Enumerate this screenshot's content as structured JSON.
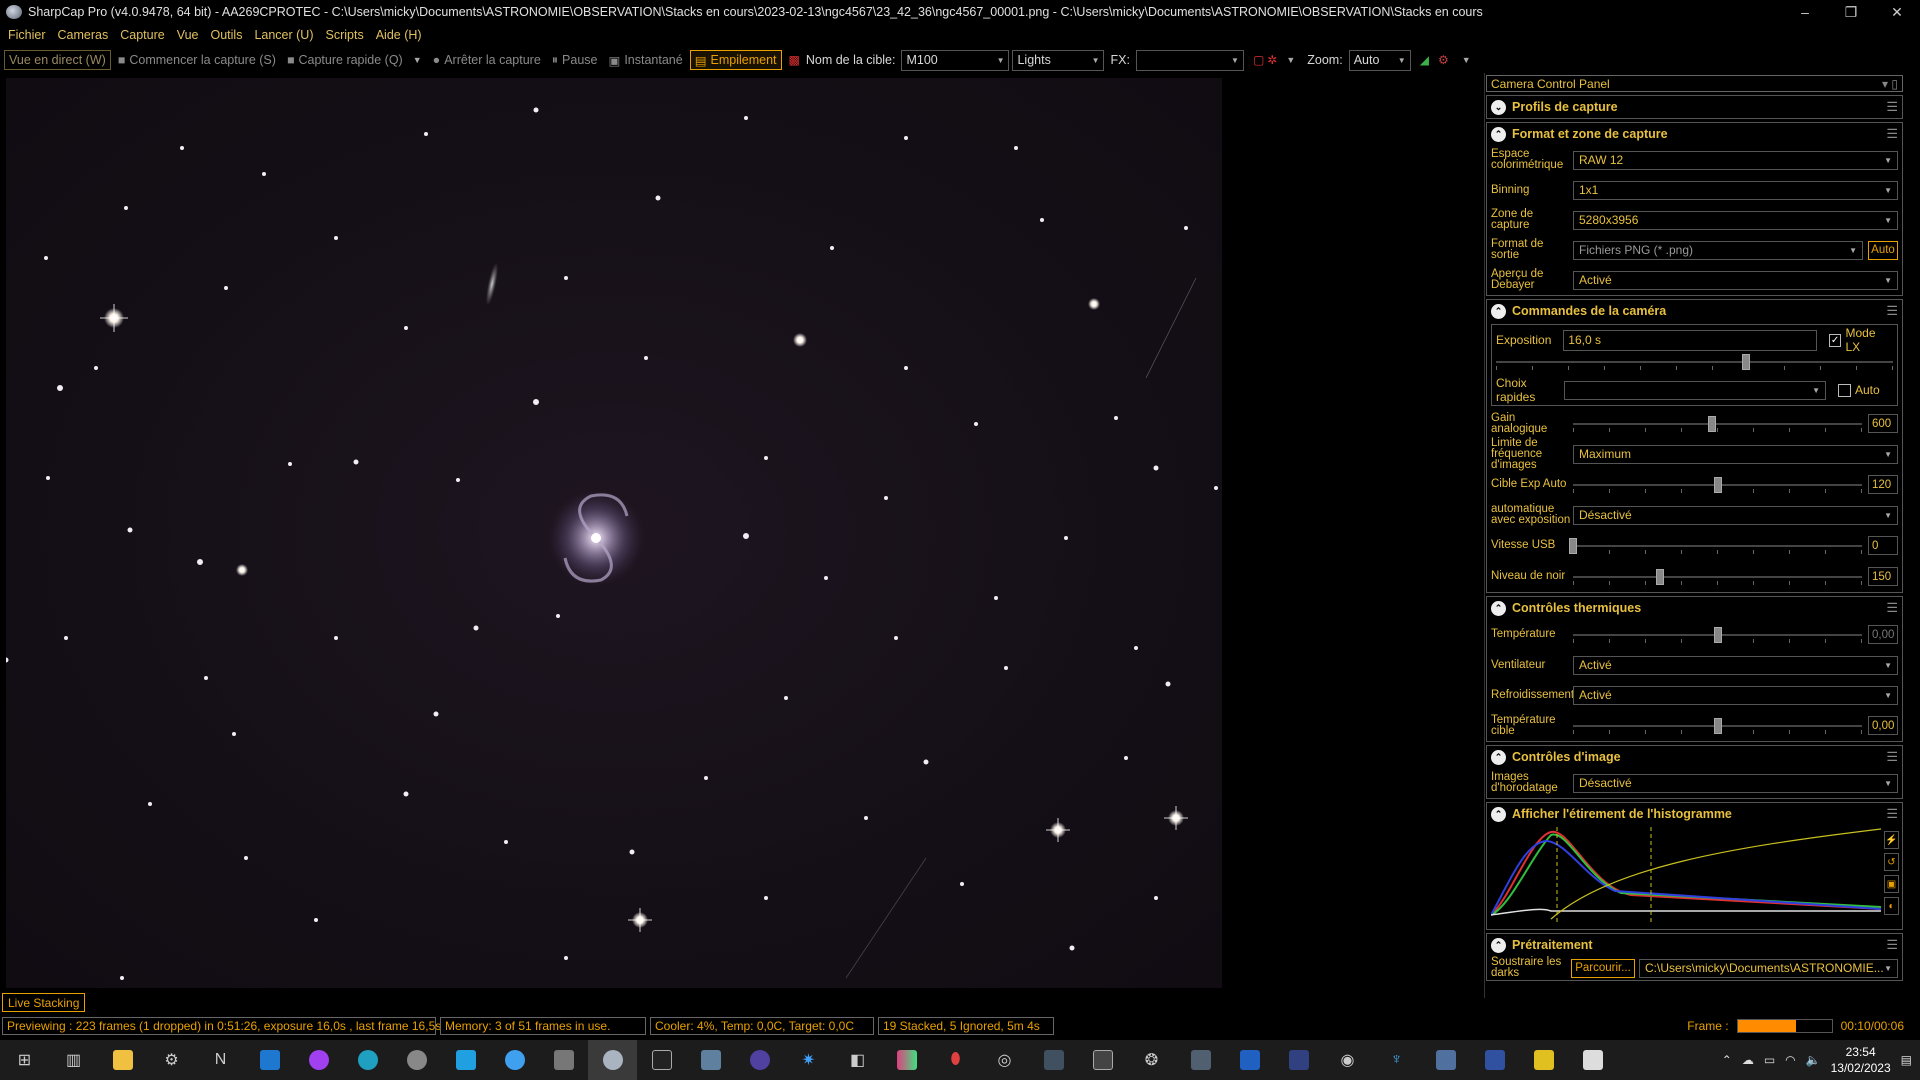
{
  "window": {
    "title": "SharpCap Pro (v4.0.9478, 64 bit) - AA269CPROTEC - C:\\Users\\micky\\Documents\\ASTRONOMIE\\OBSERVATION\\Stacks en cours\\2023-02-13\\ngc4567\\23_42_36\\ngc4567_00001.png - C:\\Users\\micky\\Documents\\ASTRONOMIE\\OBSERVATION\\Stacks en cours",
    "minimize": "–",
    "maximize": "❐",
    "close": "✕"
  },
  "menu": {
    "items": [
      "Fichier",
      "Cameras",
      "Capture",
      "Vue",
      "Outils",
      "Lancer (U)",
      "Scripts",
      "Aide (H)"
    ]
  },
  "toolbar": {
    "live_view": "Vue en direct (W)",
    "start_capture": "Commencer la capture (S)",
    "quick_capture": "Capture rapide (Q)",
    "stop_capture": "Arrêter la capture",
    "pause": "Pause",
    "snapshot": "Instantané",
    "stacking": "Empilement",
    "target_label": "Nom de la cible:",
    "target_value": "M100",
    "frame_type": "Lights",
    "fx_label": "FX:",
    "fx_value": "",
    "zoom_label": "Zoom:",
    "zoom_value": "Auto"
  },
  "live_stacking_tab": "Live Stacking",
  "panel": {
    "title": "Camera Control Panel",
    "sections": {
      "profiles": "Profils de capture",
      "format": "Format et zone de capture",
      "camera": "Commandes de la caméra",
      "thermal": "Contrôles thermiques",
      "image": "Contrôles d'image",
      "histogram": "Afficher l'étirement de l'histogramme",
      "preprocessing": "Prétraitement"
    },
    "format": {
      "colorspace_label": "Espace colorimétrique",
      "colorspace": "RAW 12",
      "binning_label": "Binning",
      "binning": "1x1",
      "zone_label": "Zone de capture",
      "zone": "5280x3956",
      "output_label": "Format de sortie",
      "output": "Fichiers PNG (* .png)",
      "output_auto": "Auto",
      "debayer_label": "Aperçu de Debayer",
      "debayer": "Activé"
    },
    "camera": {
      "exposure_label": "Exposition",
      "exposure": "16,0 s",
      "lx_label": "Mode LX",
      "quick_label": "Choix rapides",
      "quick_auto": "Auto",
      "gain_label": "Gain analogique",
      "gain": "600",
      "gain_level": 0.48,
      "fps_label": "Limite de fréquence d'images",
      "fps": "Maximum",
      "target_exp_label": "Cible Exp Auto",
      "target_exp": "120",
      "target_exp_level": 0.5,
      "auto_exp_label": "automatique avec exposition",
      "auto_exp": "Désactivé",
      "usb_label": "Vitesse USB",
      "usb": "0",
      "usb_level": 0.0,
      "black_label": "Niveau de noir",
      "black": "150",
      "black_level": 0.3
    },
    "thermal": {
      "temp_label": "Température",
      "temp": "0,00",
      "temp_level": 0.5,
      "fan_label": "Ventilateur",
      "fan": "Activé",
      "cooling_label": "Refroidissement",
      "cooling": "Activé",
      "target_temp_label": "Température cible",
      "target_temp": "0,00",
      "target_temp_level": 0.5
    },
    "image": {
      "timestamp_label": "Images d'horodatage",
      "timestamp": "Désactivé"
    },
    "pre": {
      "darks_label": "Soustraire les darks",
      "browse": "Parcourir...",
      "darks_path": "C:\\Users\\micky\\Documents\\ASTRONOMIE..."
    }
  },
  "status": {
    "preview": "Previewing : 223 frames (1 dropped) in 0:51:26, exposure 16,0s , last frame 16,5s",
    "memory": "Memory: 3 of 51 frames in use.",
    "cooler": "Cooler: 4%, Temp: 0,0C, Target: 0,0C",
    "stacked": "19 Stacked, 5 Ignored, 5m 4s",
    "frame_label": "Frame :",
    "frame_progress": 0.62,
    "frame_time": "00:10/00:06"
  },
  "taskbar": {
    "time": "23:54",
    "date": "13/02/2023",
    "icons": [
      "windows-start-icon",
      "task-view-icon",
      "file-explorer-icon",
      "settings-icon",
      "notion-icon",
      "mail-icon",
      "messenger-icon",
      "edge-icon",
      "app-icon",
      "app-icon",
      "app-icon",
      "app-icon",
      "sharpcap-icon",
      "app-icon",
      "app-icon",
      "app-icon",
      "app-icon",
      "app-icon",
      "app-icon",
      "app-icon",
      "app-icon",
      "app-icon",
      "app-icon",
      "app-icon",
      "app-icon",
      "app-icon",
      "app-icon",
      "app-icon",
      "app-icon",
      "app-icon"
    ]
  }
}
